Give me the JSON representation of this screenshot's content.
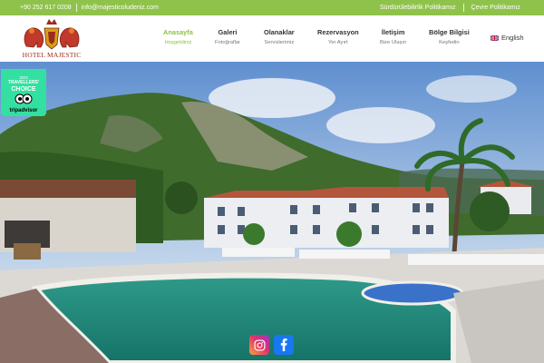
{
  "topbar": {
    "phone": "+90 252 617 0208",
    "email": "info@majesticoludeniz.com",
    "links": [
      "Sürdürülebilirlik Politikamız",
      "Çevre Politikamız"
    ]
  },
  "logo": {
    "text": "HOTEL MAJESTIC"
  },
  "nav": [
    {
      "label": "Anasayfa",
      "sub": "Hoşgeldiniz"
    },
    {
      "label": "Galeri",
      "sub": "Fotoğraflar"
    },
    {
      "label": "Olanaklar",
      "sub": "Servislerimiz"
    },
    {
      "label": "Rezervasyon",
      "sub": "Yer Ayırt"
    },
    {
      "label": "İletişim",
      "sub": "Bize Ulaşın"
    },
    {
      "label": "Bölge Bilgisi",
      "sub": "Keşfedin"
    }
  ],
  "language": {
    "label": "English",
    "flag_icon": "uk-flag-icon"
  },
  "badge": {
    "year": "2023",
    "line1": "TRAVELLERS'",
    "line2": "CHOICE",
    "brand": "tripadvisor"
  },
  "social": [
    "instagram-icon",
    "facebook-icon"
  ],
  "colors": {
    "accent": "#8fc24a",
    "logo_red": "#9c2d1c",
    "tripadvisor": "#34e0a1"
  }
}
